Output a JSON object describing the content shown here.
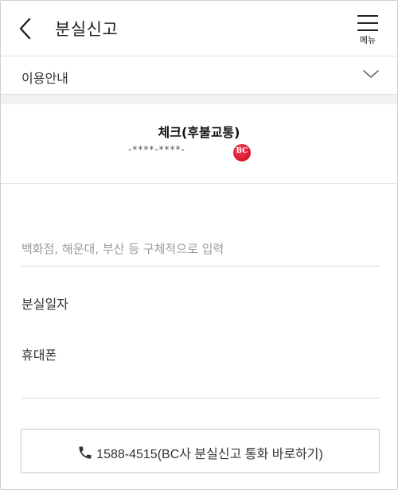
{
  "header": {
    "title": "분실신고",
    "back_icon": "chevron-left-icon",
    "menu_label": "메뉴",
    "menu_icon": "hamburger-icon"
  },
  "info": {
    "label": "이용안내",
    "toggle_icon": "chevron-down-icon"
  },
  "card": {
    "name": "체크(후불교통)",
    "number": "-****-****-",
    "brand_logo_text": "BC",
    "brand_color": "#d8152c"
  },
  "form": {
    "place_placeholder": "백화점, 해운대, 부산 등 구체적으로 입력",
    "place_value": "",
    "date_label": "분실일자",
    "phone_label": "휴대폰"
  },
  "call_button": {
    "icon": "phone-icon",
    "label": "1588-4515(BC사 분실신고 통화 바로하기)"
  }
}
